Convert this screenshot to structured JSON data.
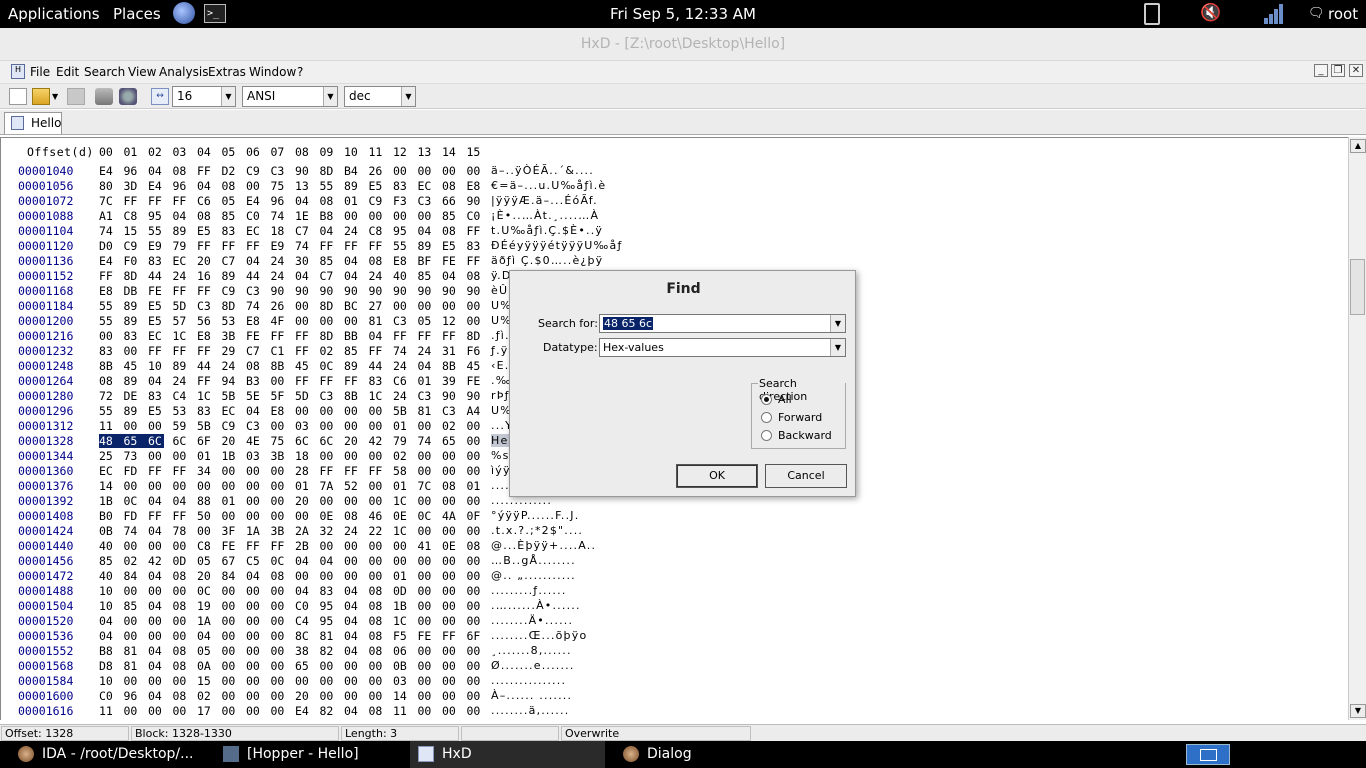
{
  "topbar": {
    "applications": "Applications",
    "places": "Places",
    "datetime": "Fri Sep  5, 12:33 AM",
    "user": "root"
  },
  "window": {
    "title": "HxD - [Z:\\root\\Desktop\\Hello]"
  },
  "menu": {
    "file": "File",
    "edit": "Edit",
    "search": "Search",
    "view": "View",
    "analysis": "Analysis",
    "extras": "Extras",
    "window": "Window",
    "help": "?"
  },
  "toolbar": {
    "bytes_per_row": "16",
    "charset": "ANSI",
    "offset_base": "dec"
  },
  "tab": {
    "label": "Hello"
  },
  "hex": {
    "header_offset": "Offset(d)",
    "header_cols": [
      "00",
      "01",
      "02",
      "03",
      "04",
      "05",
      "06",
      "07",
      "08",
      "09",
      "10",
      "11",
      "12",
      "13",
      "14",
      "15"
    ],
    "rows": [
      {
        "offset": "00001040",
        "bytes": "E4 96 04 08 FF D2 C9 C3 90 8D B4 26 00 00 00 00",
        "ascii": "ä–..ÿÒÉÃ..´&...."
      },
      {
        "offset": "00001056",
        "bytes": "80 3D E4 96 04 08 00 75 13 55 89 E5 83 EC 08 E8",
        "ascii": "€=ä–...u.U‰åƒì.è"
      },
      {
        "offset": "00001072",
        "bytes": "7C FF FF FF C6 05 E4 96 04 08 01 C9 F3 C3 66 90",
        "ascii": "|ÿÿÿÆ.ä–...ÉóÃf."
      },
      {
        "offset": "00001088",
        "bytes": "A1 C8 95 04 08 85 C0 74 1E B8 00 00 00 00 85 C0",
        "ascii": "¡È•..…Àt.¸....…À"
      },
      {
        "offset": "00001104",
        "bytes": "74 15 55 89 E5 83 EC 18 C7 04 24 C8 95 04 08 FF",
        "ascii": "t.U‰åƒì.Ç.$È•..ÿ"
      },
      {
        "offset": "00001120",
        "bytes": "D0 C9 E9 79 FF FF FF E9 74 FF FF FF 55 89 E5 83",
        "ascii": "ÐÉéyÿÿÿétÿÿÿU‰åƒ"
      },
      {
        "offset": "00001136",
        "bytes": "E4 F0 83 EC 20 C7 04 24 30 85 04 08 E8 BF FE FF",
        "ascii": "äðƒì Ç.$0…..è¿þÿ"
      },
      {
        "offset": "00001152",
        "bytes": "FF 8D 44 24 16 89 44 24 04 C7 04 24 40 85 04 08",
        "ascii": "ÿ.D$.‰D$.Ç.$@….."
      },
      {
        "offset": "00001168",
        "bytes": "E8 DB FE FF FF C9 C3 90 90 90 90 90 90 90 90 90",
        "ascii": "èÛþÿÿÉÃ........."
      },
      {
        "offset": "00001184",
        "bytes": "55 89 E5 5D C3 8D 74 26 00 8D BC 27 00 00 00 00",
        "ascii": "U‰å]Ã.t&..¼'...."
      },
      {
        "offset": "00001200",
        "bytes": "55 89 E5 57 56 53 E8 4F 00 00 00 81 C3 05 12 00",
        "ascii": "U‰åWVSèO....Ã..."
      },
      {
        "offset": "00001216",
        "bytes": "00 83 EC 1C E8 3B FE FF FF 8D BB 04 FF FF FF 8D",
        "ascii": ".ƒì.è;þÿÿ.».ÿÿÿ."
      },
      {
        "offset": "00001232",
        "bytes": "83 00 FF FF FF 29 C7 C1 FF 02 85 FF 74 24 31 F6",
        "ascii": "ƒ.ÿÿÿ)ÇÁÿ.…ÿt$1ö"
      },
      {
        "offset": "00001248",
        "bytes": "8B 45 10 89 44 24 08 8B 45 0C 89 44 24 04 8B 45",
        "ascii": "‹E.‰D$.‹E.‰D$.‹E"
      },
      {
        "offset": "00001264",
        "bytes": "08 89 04 24 FF 94 B3 00 FF FF FF 83 C6 01 39 FE",
        "ascii": ".‰.$ÿ”³.ÿÿÿƒÆ.9þ"
      },
      {
        "offset": "00001280",
        "bytes": "72 DE 83 C4 1C 5B 5E 5F 5D C3 8B 1C 24 C3 90 90",
        "ascii": "rÞƒÄ.[^_]Ã‹.$Ã.."
      },
      {
        "offset": "00001296",
        "bytes": "55 89 E5 53 83 EC 04 E8 00 00 00 00 5B 81 C3 A4",
        "ascii": "U‰åSƒì.è....[Ã¤"
      },
      {
        "offset": "00001312",
        "bytes": "11 00 00 59 5B C9 C3 00 03 00 00 00 01 00 02 00",
        "ascii": "...Y[ÉÃ........."
      },
      {
        "offset": "00001328",
        "bytes": "48 65 6C 6C 6F 20 4E 75 6C 6C 20 42 79 74 65 00",
        "ascii": "Hello Null Byte."
      },
      {
        "offset": "00001344",
        "bytes": "25 73 00 00 01 1B 03 3B 18 00 00 00 02 00 00 00",
        "ascii": "%s.....;........"
      },
      {
        "offset": "00001360",
        "bytes": "EC FD FF FF 34 00 00 00 28 FF FF FF 58 00 00 00",
        "ascii": "ìýÿÿ4...(ÿÿÿX..."
      },
      {
        "offset": "00001376",
        "bytes": "14 00 00 00 00 00 00 00 01 7A 52 00 01 7C 08 01",
        "ascii": "........."
      },
      {
        "offset": "00001392",
        "bytes": "1B 0C 04 04 88 01 00 00 20 00 00 00 1C 00 00 00",
        "ascii": "............."
      },
      {
        "offset": "00001408",
        "bytes": "B0 FD FF FF 50 00 00 00 00 0E 08 46 0E 0C 4A 0F",
        "ascii": "°ýÿÿP......F..J."
      },
      {
        "offset": "00001424",
        "bytes": "0B 74 04 78 00 3F 1A 3B 2A 32 24 22 1C 00 00 00",
        "ascii": ".t.x.?.;*2$\"...."
      },
      {
        "offset": "00001440",
        "bytes": "40 00 00 00 C8 FE FF FF 2B 00 00 00 00 41 0E 08",
        "ascii": "@...Èþÿÿ+....A.."
      },
      {
        "offset": "00001456",
        "bytes": "85 02 42 0D 05 67 C5 0C 04 04 00 00 00 00 00 00",
        "ascii": "…B..gÅ........"
      },
      {
        "offset": "00001472",
        "bytes": "40 84 04 08 20 84 04 08 00 00 00 00 01 00 00 00",
        "ascii": "@.. „..........."
      },
      {
        "offset": "00001488",
        "bytes": "10 00 00 00 0C 00 00 00 04 83 04 08 0D 00 00 00",
        "ascii": ".........ƒ......"
      },
      {
        "offset": "00001504",
        "bytes": "10 85 04 08 19 00 00 00 C0 95 04 08 1B 00 00 00",
        "ascii": ".…......À•......"
      },
      {
        "offset": "00001520",
        "bytes": "04 00 00 00 1A 00 00 00 C4 95 04 08 1C 00 00 00",
        "ascii": "........Ä•......"
      },
      {
        "offset": "00001536",
        "bytes": "04 00 00 00 04 00 00 00 8C 81 04 08 F5 FE FF 6F",
        "ascii": "........Œ...õþÿo"
      },
      {
        "offset": "00001552",
        "bytes": "B8 81 04 08 05 00 00 00 38 82 04 08 06 00 00 00",
        "ascii": "¸.......8‚......"
      },
      {
        "offset": "00001568",
        "bytes": "D8 81 04 08 0A 00 00 00 65 00 00 00 0B 00 00 00",
        "ascii": "Ø.......e......."
      },
      {
        "offset": "00001584",
        "bytes": "10 00 00 00 15 00 00 00 00 00 00 00 03 00 00 00",
        "ascii": "................"
      },
      {
        "offset": "00001600",
        "bytes": "C0 96 04 08 02 00 00 00 20 00 00 00 14 00 00 00",
        "ascii": "À–...... ......."
      },
      {
        "offset": "00001616",
        "bytes": "11 00 00 00 17 00 00 00 E4 82 04 08 11 00 00 00",
        "ascii": "........ä‚......"
      }
    ]
  },
  "status": {
    "offset": "Offset: 1328",
    "block": "Block: 1328-1330",
    "length": "Length: 3",
    "mode": "Overwrite"
  },
  "find": {
    "title": "Find",
    "search_label": "Search for:",
    "search_value": "48 65 6c",
    "datatype_label": "Datatype:",
    "datatype_value": "Hex-values",
    "direction_title": "Search direction",
    "dir_all": "All",
    "dir_forward": "Forward",
    "dir_backward": "Backward",
    "selected_direction": "All",
    "ok": "OK",
    "cancel": "Cancel"
  },
  "taskbar": {
    "ida": "IDA - /root/Desktop/...",
    "hopper": "[Hopper - Hello]",
    "hxd": "HxD",
    "dialog": "Dialog"
  },
  "colors": {
    "selection": "#0a246a",
    "offset_text": "#00008b",
    "topbar": "#000000"
  }
}
